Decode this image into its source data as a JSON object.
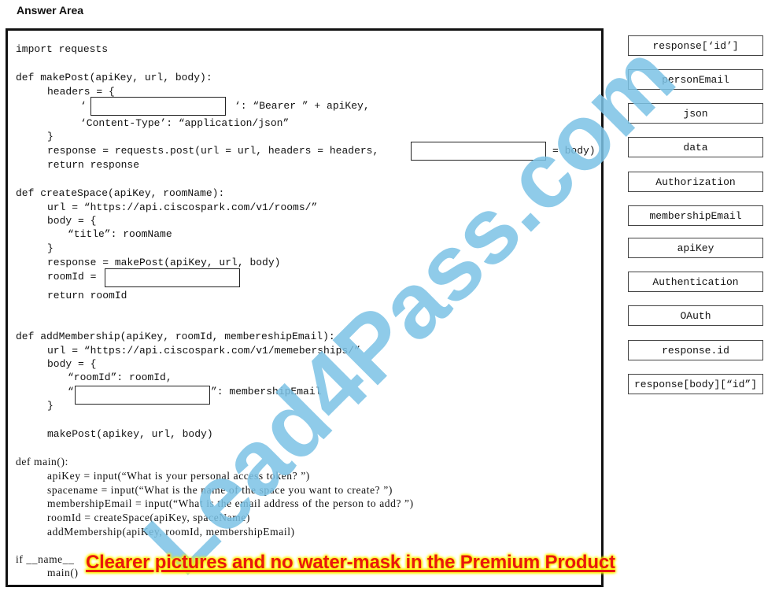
{
  "header": {
    "title": "Answer Area"
  },
  "code": {
    "lines": [
      "import requests",
      "def makePost(apiKey, url, body):",
      "headers = {",
      "‘",
      "‘: “Bearer ” + apiKey,",
      "‘Content-Type’: “application/json”",
      "}",
      "response = requests.post(url = url, headers = headers,",
      "= body)",
      "return response",
      "def createSpace(apiKey, roomName):",
      "url = “https://api.ciscospark.com/v1/rooms/”",
      "body = {",
      "“title”: roomName",
      "}",
      "response = makePost(apiKey, url, body)",
      "roomId =",
      "return roomId",
      "def addMembership(apiKey, roomId, membereshipEmail):",
      "url = “https://api.ciscospark.com/v1/memeberships/”",
      "body = {",
      "“roomId”: roomId,",
      "“",
      "”: membershipEmail",
      "}",
      "makePost(apikey, url, body)",
      "def main():",
      "apiKey = input(“What is your personal access token? ”)",
      "spacename = input(“What is the name of the space you want to create? ”)",
      "membershipEmail = input(“What is the email address of the person to add? ”)",
      "roomId = createSpace(apiKey, spaceName)",
      "addMembership(apiKey, roomId, membershipEmail)",
      "if __name__",
      "main()"
    ]
  },
  "drop_slots": [
    {
      "id": "header-key-slot",
      "value": ""
    },
    {
      "id": "post-body-param-slot",
      "value": ""
    },
    {
      "id": "room-id-slot",
      "value": ""
    },
    {
      "id": "membership-key-slot",
      "value": ""
    }
  ],
  "tokens": [
    "response[‘id’]",
    "personEmail",
    "json",
    "data",
    "Authorization",
    "membershipEmail",
    "apiKey",
    "Authentication",
    "OAuth",
    "response.id",
    "response[body][“id”]"
  ],
  "watermark": {
    "text": "Lead4Pass.com",
    "color": "#7cc3e6"
  },
  "banner": {
    "text": "Clearer pictures and no water-mask in the Premium Product",
    "color": "#e8170e",
    "glow": "#fff200"
  }
}
